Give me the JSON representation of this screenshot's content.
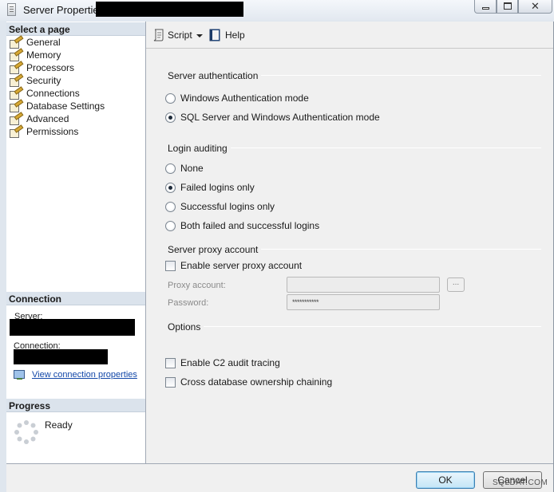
{
  "window": {
    "title": "Server Properties",
    "close_glyph": "✕"
  },
  "select_page": {
    "heading": "Select a page",
    "items": [
      {
        "label": "General",
        "icon": "page-icon"
      },
      {
        "label": "Memory",
        "icon": "page-icon"
      },
      {
        "label": "Processors",
        "icon": "page-icon"
      },
      {
        "label": "Security",
        "icon": "page-icon",
        "selected": true
      },
      {
        "label": "Connections",
        "icon": "page-icon"
      },
      {
        "label": "Database Settings",
        "icon": "page-icon"
      },
      {
        "label": "Advanced",
        "icon": "page-icon"
      },
      {
        "label": "Permissions",
        "icon": "page-icon"
      }
    ]
  },
  "connection": {
    "heading": "Connection",
    "server_label": "Server:",
    "connection_label": "Connection:",
    "view_link": "View connection properties"
  },
  "progress": {
    "heading": "Progress",
    "status": "Ready"
  },
  "toolbar": {
    "script_label": "Script",
    "help_label": "Help"
  },
  "server_auth": {
    "heading": "Server authentication",
    "options": [
      "Windows Authentication mode",
      "SQL Server and Windows Authentication mode"
    ],
    "selected": 1
  },
  "login_auditing": {
    "heading": "Login auditing",
    "options": [
      "None",
      "Failed logins only",
      "Successful logins only",
      "Both failed and successful logins"
    ],
    "selected": 1
  },
  "proxy": {
    "heading": "Server proxy account",
    "enable_label": "Enable server proxy account",
    "enabled": false,
    "account_label": "Proxy account:",
    "account_value": "",
    "browse_label": "...",
    "password_label": "Password:",
    "password_value": "***********"
  },
  "options": {
    "heading": "Options",
    "c2_label": "Enable C2 audit tracing",
    "c2_checked": false,
    "chaining_label": "Cross database ownership chaining",
    "chaining_checked": false
  },
  "buttons": {
    "ok": "OK",
    "cancel": "Cancel"
  },
  "watermark": "SQLDAT.COM",
  "colors": {
    "accent": "#1247a8",
    "panel_header": "#dbe3ec",
    "content_bg": "#f0f0f0"
  }
}
